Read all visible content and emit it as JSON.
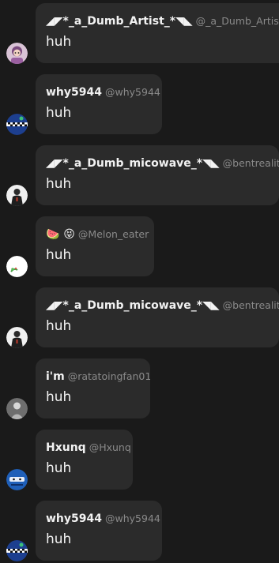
{
  "messages": [
    {
      "display_name": "◢◤*_a_Dumb_Artist_*◥◣",
      "handle": "@_a_Dumb_Artist_",
      "text": "huh",
      "avatar": "avatar-pink-character-icon"
    },
    {
      "display_name": "why5944",
      "handle": "@why5944",
      "text": "huh",
      "avatar": "avatar-blue-checkered-icon"
    },
    {
      "display_name": "◢◤*_a_Dumb_micowave_*◥◣",
      "handle": "@bentreality",
      "text": "huh",
      "avatar": "avatar-dark-figure-icon"
    },
    {
      "display_name": "🍉 😝",
      "handle": "@Melon_eater",
      "text": "huh",
      "avatar": "avatar-white-plant-icon"
    },
    {
      "display_name": "◢◤*_a_Dumb_micowave_*◥◣",
      "handle": "@bentreality",
      "text": "huh",
      "avatar": "avatar-dark-figure-icon"
    },
    {
      "display_name": "i'm",
      "handle": "@ratatoingfan01",
      "text": "huh",
      "avatar": "avatar-grey-figure-icon"
    },
    {
      "display_name": "Hxunq",
      "handle": "@Hxunq",
      "text": "huh",
      "avatar": "avatar-blue-face-icon"
    },
    {
      "display_name": "why5944",
      "handle": "@why5944",
      "text": "huh",
      "avatar": "avatar-blue-checkered-icon"
    }
  ],
  "colors": {
    "background": "#1a1a1a",
    "bubble": "#2b2b2b",
    "name": "#f2f2f2",
    "handle": "#8a8a8a"
  }
}
